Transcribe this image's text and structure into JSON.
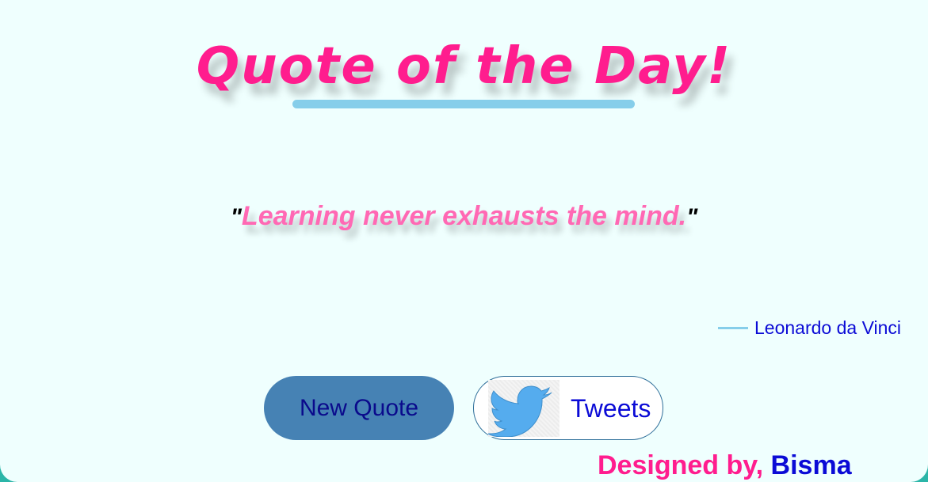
{
  "header": {
    "title": "Quote of the Day!"
  },
  "quote": {
    "open_mark": "\"",
    "text": "Learning never exhausts the mind.",
    "close_mark": "\""
  },
  "author": {
    "name": "Leonardo da Vinci"
  },
  "actions": {
    "new_quote_label": "New Quote",
    "tweet_label": "Tweets",
    "tweet_icon": "twitter-bird-icon"
  },
  "footer": {
    "prefix": "Designed by,",
    "name": "Bisma"
  },
  "colors": {
    "title": "#ff1d8e",
    "quote_text": "#ff69b4",
    "underline": "#86ceea",
    "background": "#effffe",
    "new_quote_button": "#4682b4",
    "link_blue": "#0b0bd6",
    "twitter_blue": "#55acee"
  }
}
